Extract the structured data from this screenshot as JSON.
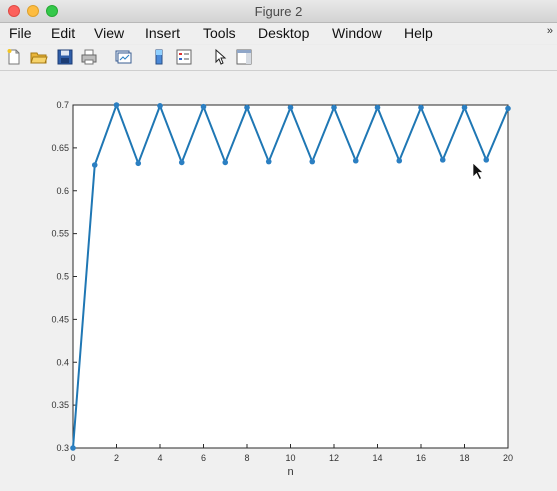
{
  "window": {
    "title": "Figure 2"
  },
  "menu": [
    "File",
    "Edit",
    "View",
    "Insert",
    "Tools",
    "Desktop",
    "Window",
    "Help"
  ],
  "toolbar": {
    "icons": [
      "new-figure-icon",
      "open-file-icon",
      "save-icon",
      "print-icon",
      "link-plot-icon",
      "insert-colorbar-icon",
      "insert-legend-icon",
      "edit-plot-arrow-icon",
      "show-plot-tools-icon"
    ]
  },
  "colors": {
    "line": "#1f77b4",
    "marker": "#2b7fc2"
  },
  "chart_data": {
    "type": "line",
    "xlabel": "n",
    "ylabel": "",
    "title": "",
    "xlim": [
      0,
      20
    ],
    "ylim": [
      0.3,
      0.7
    ],
    "xticks": [
      0,
      2,
      4,
      6,
      8,
      10,
      12,
      14,
      16,
      18,
      20
    ],
    "xtick_labels": [
      "0",
      "2",
      "4",
      "6",
      "8",
      "10",
      "12",
      "14",
      "16",
      "18",
      "20"
    ],
    "yticks": [
      0.3,
      0.35,
      0.4,
      0.45,
      0.5,
      0.55,
      0.6,
      0.65,
      0.7
    ],
    "ytick_labels": [
      "0.3",
      "0.35",
      "0.4",
      "0.45",
      "0.5",
      "0.55",
      "0.6",
      "0.65",
      "0.7"
    ],
    "grid": false,
    "series": [
      {
        "x": [
          0,
          1,
          2,
          3,
          4,
          5,
          6,
          7,
          8,
          9,
          10,
          11,
          12,
          13,
          14,
          15,
          16,
          17,
          18,
          19,
          20
        ],
        "y": [
          0.3,
          0.63,
          0.7,
          0.632,
          0.699,
          0.633,
          0.698,
          0.633,
          0.697,
          0.634,
          0.697,
          0.634,
          0.697,
          0.635,
          0.697,
          0.635,
          0.697,
          0.636,
          0.697,
          0.636,
          0.696
        ]
      }
    ]
  }
}
